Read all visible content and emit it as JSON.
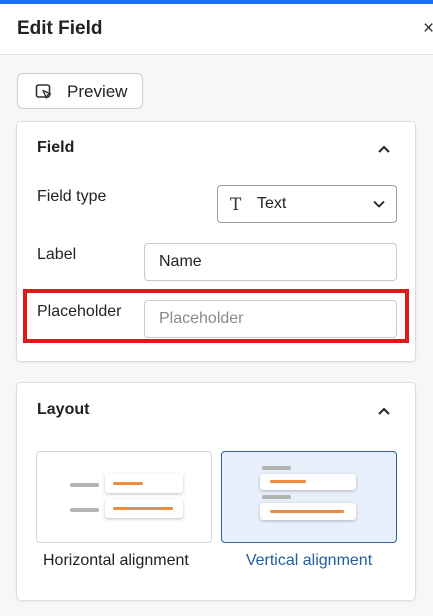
{
  "header": {
    "title": "Edit Field",
    "close_glyph": "×"
  },
  "preview_button": {
    "label": "Preview",
    "icon": "preview-play-icon"
  },
  "field_section": {
    "title": "Field",
    "collapse_icon": "chevron-up-icon",
    "field_type": {
      "label": "Field type",
      "value": "Text",
      "icon_glyph": "T"
    },
    "label_row": {
      "label": "Label",
      "value": "Name"
    },
    "placeholder_row": {
      "label": "Placeholder",
      "placeholder": "Placeholder"
    }
  },
  "layout_section": {
    "title": "Layout",
    "collapse_icon": "chevron-up-icon",
    "options": [
      {
        "label": "Horizontal alignment",
        "selected": false
      },
      {
        "label": "Vertical alignment",
        "selected": true
      }
    ]
  },
  "colors": {
    "accent": "#1a73e8",
    "highlight": "#e01818",
    "selected_bg": "#e7f0fb",
    "selected_border": "#2f5f9e",
    "illustration_orange": "#ef8b3b"
  }
}
